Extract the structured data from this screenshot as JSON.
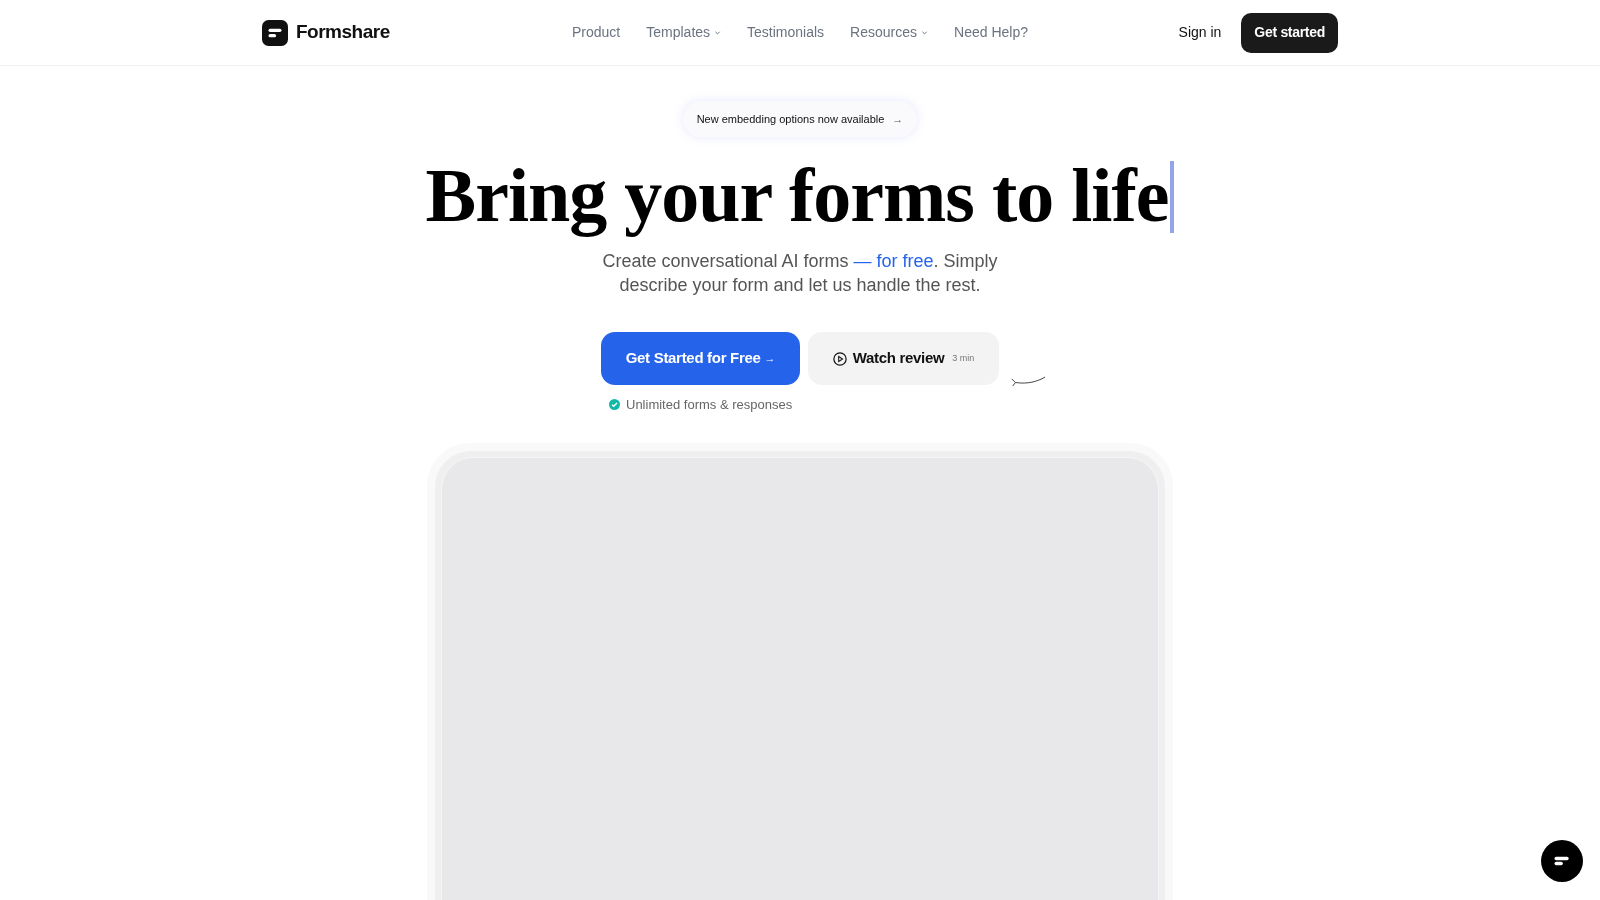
{
  "brand": {
    "name": "Formshare"
  },
  "nav": [
    {
      "label": "Product",
      "has_dropdown": false
    },
    {
      "label": "Templates",
      "has_dropdown": true
    },
    {
      "label": "Testimonials",
      "has_dropdown": false
    },
    {
      "label": "Resources",
      "has_dropdown": true
    },
    {
      "label": "Need Help?",
      "has_dropdown": false
    }
  ],
  "sign_in": "Sign in",
  "get_started": "Get started",
  "announcement": {
    "text": "New embedding options now available",
    "arrow": "→"
  },
  "headline": "Bring your forms to life",
  "subtitle": [
    {
      "kind": "plain",
      "text": "Create conversational AI forms "
    },
    {
      "kind": "accent",
      "text": "— for free"
    },
    {
      "kind": "plain",
      "text": ". Simply describe your form and let us handle the rest."
    }
  ],
  "primary_cta": {
    "label": "Get Started for Free",
    "arrow": "→"
  },
  "secondary_cta": {
    "label": "Watch review",
    "duration": "3 min"
  },
  "note": "Unlimited forms & responses"
}
